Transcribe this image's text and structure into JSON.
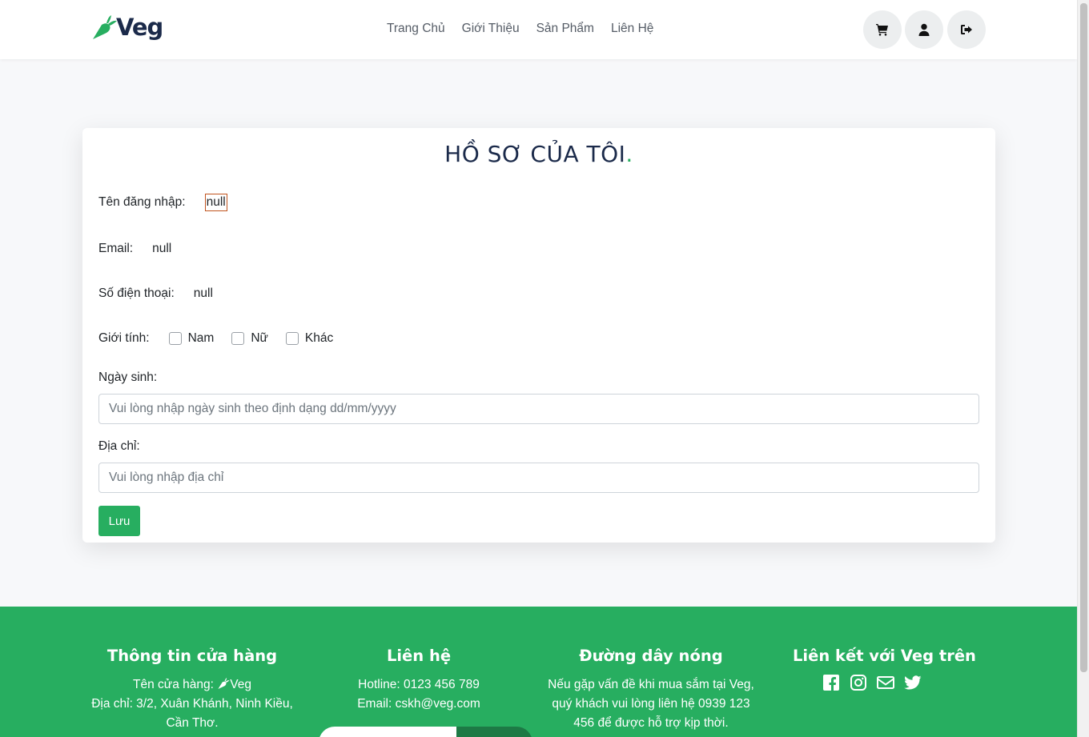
{
  "brand": {
    "name": "Veg"
  },
  "nav": {
    "items": [
      "Trang Chủ",
      "Giới Thiệu",
      "Sản Phẩm",
      "Liên Hệ"
    ]
  },
  "header_icons": [
    "cart-icon",
    "user-icon",
    "logout-icon"
  ],
  "profile": {
    "title": "HỒ SƠ CỦA TÔI",
    "title_dot": ".",
    "username_label": "Tên đăng nhập:",
    "username_value": "null",
    "email_label": "Email:",
    "email_value": "null",
    "phone_label": "Số điện thoại:",
    "phone_value": "null",
    "gender_label": "Giới tính:",
    "gender_options": [
      "Nam",
      "Nữ",
      "Khác"
    ],
    "birthday_label": "Ngày sinh:",
    "birthday_placeholder": "Vui lòng nhập ngày sinh theo định dạng dd/mm/yyyy",
    "address_label": "Địa chỉ:",
    "address_placeholder": "Vui lòng nhập địa chỉ",
    "save_label": "Lưu"
  },
  "footer": {
    "store": {
      "title": "Thông tin cửa hàng",
      "name_prefix": "Tên cửa hàng:",
      "name_value": "Veg",
      "address": "Địa chỉ: 3/2, Xuân Khánh, Ninh Kiều, Cần Thơ."
    },
    "contact": {
      "title": "Liên hệ",
      "hotline": "Hotline: 0123 456 789",
      "email": "Email: cskh@veg.com"
    },
    "hotline": {
      "title": "Đường dây nóng",
      "text": "Nếu gặp vấn đề khi mua sắm tại Veg, quý khách vui lòng liên hệ 0939 123 456 để được hỗ trợ kịp thời."
    },
    "social": {
      "title": "Liên kết với Veg trên",
      "icons": [
        "facebook-icon",
        "instagram-icon",
        "email-icon",
        "twitter-icon"
      ]
    }
  },
  "colors": {
    "accent": "#27ae60",
    "brand_dark": "#1b2a4a",
    "focus_border": "#c0531e"
  }
}
